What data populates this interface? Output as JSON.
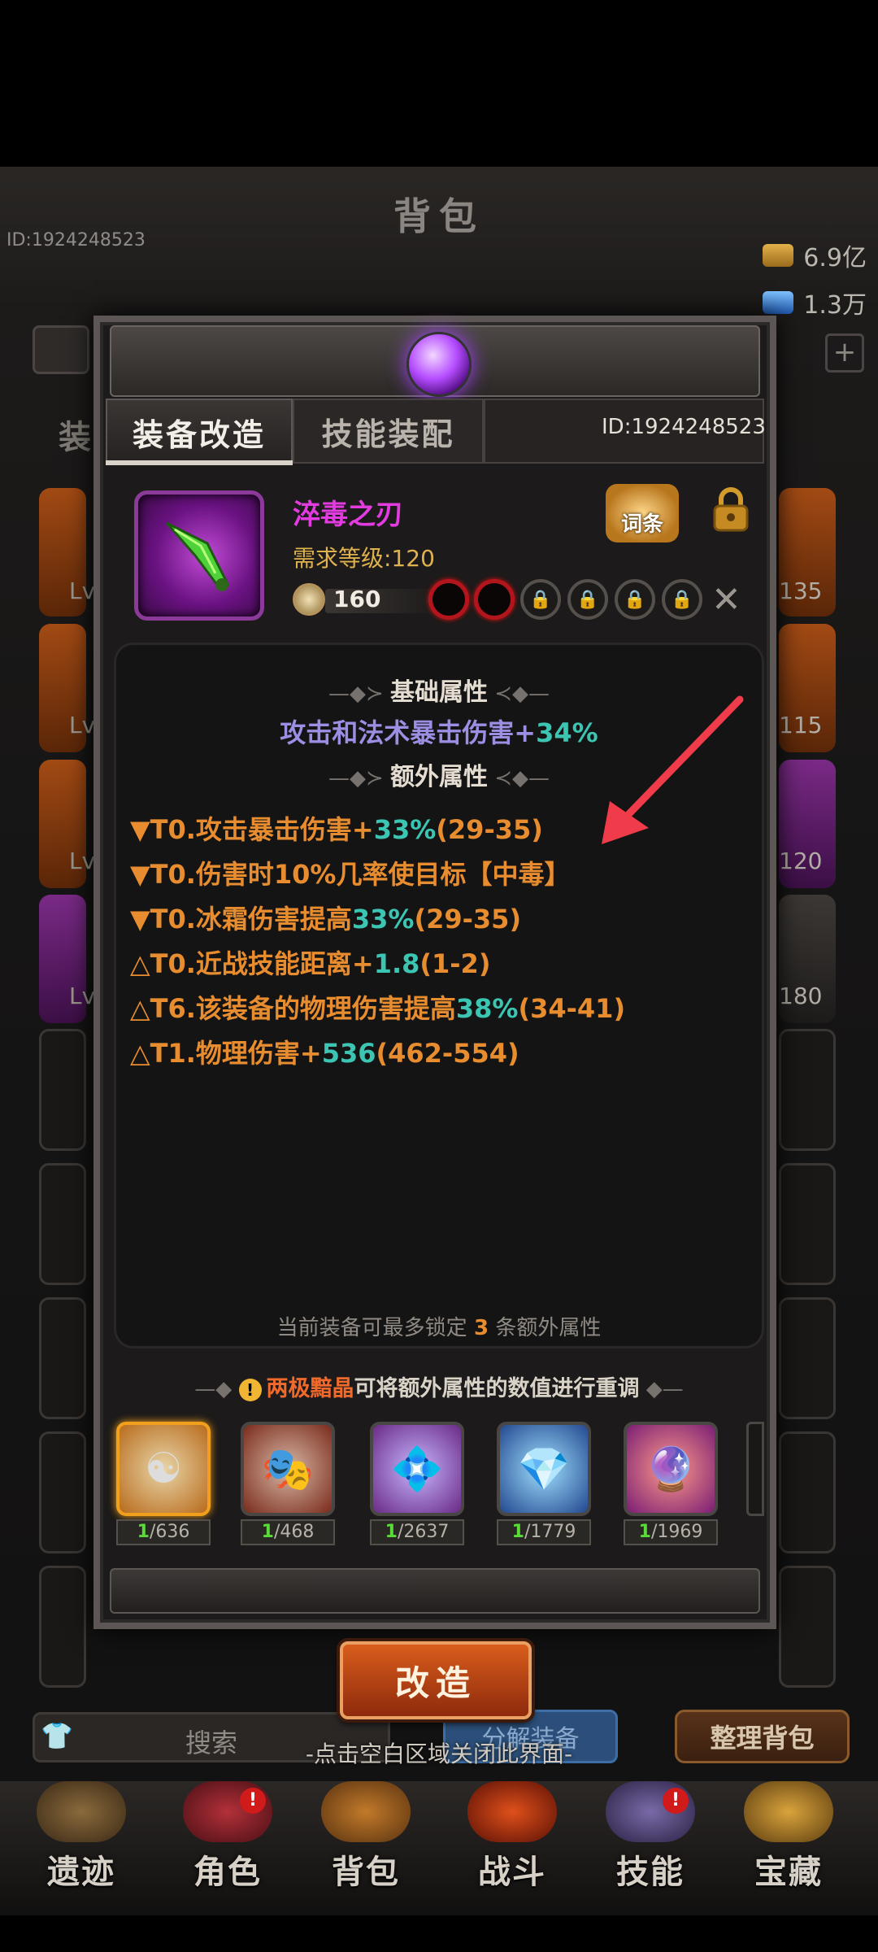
{
  "background": {
    "title": "背包",
    "player_id": "ID:1924248523",
    "gold": "6.9亿",
    "gems": "1.3万",
    "level_labels": [
      "Lv",
      "Lv",
      "Lv",
      "Lv"
    ],
    "right_levels": [
      "135",
      "115",
      "120",
      "180"
    ],
    "tab_peek": "装"
  },
  "modal": {
    "tabs": [
      "装备改造",
      "技能装配"
    ],
    "id_label": "ID:1924248523",
    "item": {
      "name": "淬毒之刃",
      "requirement": "需求等级:120",
      "power": "160",
      "affix_button": "词条"
    },
    "base_section_title": "基础属性",
    "base_attribute_parts": [
      "攻击和法术暴击伤害+",
      "34%"
    ],
    "extra_section_title": "额外属性",
    "extra_attributes": [
      {
        "prefix": "▼T0.攻击暴击伤害+",
        "value": "33%",
        "range": "(29-35)"
      },
      {
        "prefix": "▼T0.伤害时10%几率使目标【中毒】",
        "value": "",
        "range": ""
      },
      {
        "prefix": "▼T0.冰霜伤害提高",
        "value": "33%",
        "range": "(29-35)"
      },
      {
        "prefix": "△T0.近战技能距离+",
        "value": "1.8",
        "range": "(1-2)"
      },
      {
        "prefix": "△T6.该装备的物理伤害提高",
        "value": "38%",
        "range": "(34-41)"
      },
      {
        "prefix": "△T1.物理伤害+",
        "value": "536",
        "range": "(462-554)"
      }
    ],
    "lock_note_before": "当前装备可最多锁定",
    "lock_count": "3",
    "lock_note_after": "条额外属性",
    "reroll_item": "两极黯晶",
    "reroll_text": "可将额外属性的数值进行重调",
    "materials": [
      {
        "have": "1",
        "total": "/636",
        "icon": "yin-yang-stone-icon",
        "color": "#b86b1c"
      },
      {
        "have": "1",
        "total": "/468",
        "icon": "twin-masks-icon",
        "color": "#7a2b1c"
      },
      {
        "have": "1",
        "total": "/2637",
        "icon": "purple-crystal-icon",
        "color": "#6a2a86"
      },
      {
        "have": "1",
        "total": "/1779",
        "icon": "prism-gem-icon",
        "color": "#23488f"
      },
      {
        "have": "1",
        "total": "/1969",
        "icon": "ruby-ore-icon",
        "color": "#7a1e74"
      }
    ],
    "reforge_button": "改造"
  },
  "lower": {
    "search": "搜索",
    "decompose": "分解装备",
    "sort": "整理背包",
    "close_hint": "-点击空白区域关闭此界面-"
  },
  "nav": [
    {
      "label": "遗迹",
      "badge": ""
    },
    {
      "label": "角色",
      "badge": "!"
    },
    {
      "label": "背包",
      "badge": ""
    },
    {
      "label": "战斗",
      "badge": ""
    },
    {
      "label": "技能",
      "badge": "!"
    },
    {
      "label": "宝藏",
      "badge": ""
    }
  ],
  "colors": {
    "item_name": "#e23ce0",
    "attr_orange": "#e88d2f",
    "attr_teal": "#3bc5b2",
    "base_attr": "#9b8ee3",
    "annotation_arrow": "#ef3b4a"
  }
}
